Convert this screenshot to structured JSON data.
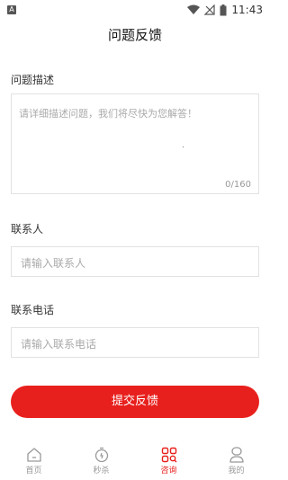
{
  "status_bar": {
    "notif_glyph": "A",
    "time": "11:43"
  },
  "page": {
    "title": "问题反馈"
  },
  "description": {
    "label": "问题描述",
    "placeholder": "请详细描述问题，我们将尽快为您解答！",
    "counter": "0/160"
  },
  "contact": {
    "label": "联系人",
    "placeholder": "请输入联系人"
  },
  "phone": {
    "label": "联系电话",
    "placeholder": "请输入联系电话"
  },
  "submit_label": "提交反馈",
  "tabbar": {
    "items": [
      {
        "label": "首页",
        "icon": "home-icon",
        "active": false
      },
      {
        "label": "秒杀",
        "icon": "stopwatch-icon",
        "active": false
      },
      {
        "label": "咨询",
        "icon": "grid-search-icon",
        "active": true
      },
      {
        "label": "我的",
        "icon": "person-icon",
        "active": false
      }
    ]
  },
  "colors": {
    "accent": "#e8201d",
    "border": "#e2e2e2",
    "placeholder": "#aaaaaa"
  }
}
